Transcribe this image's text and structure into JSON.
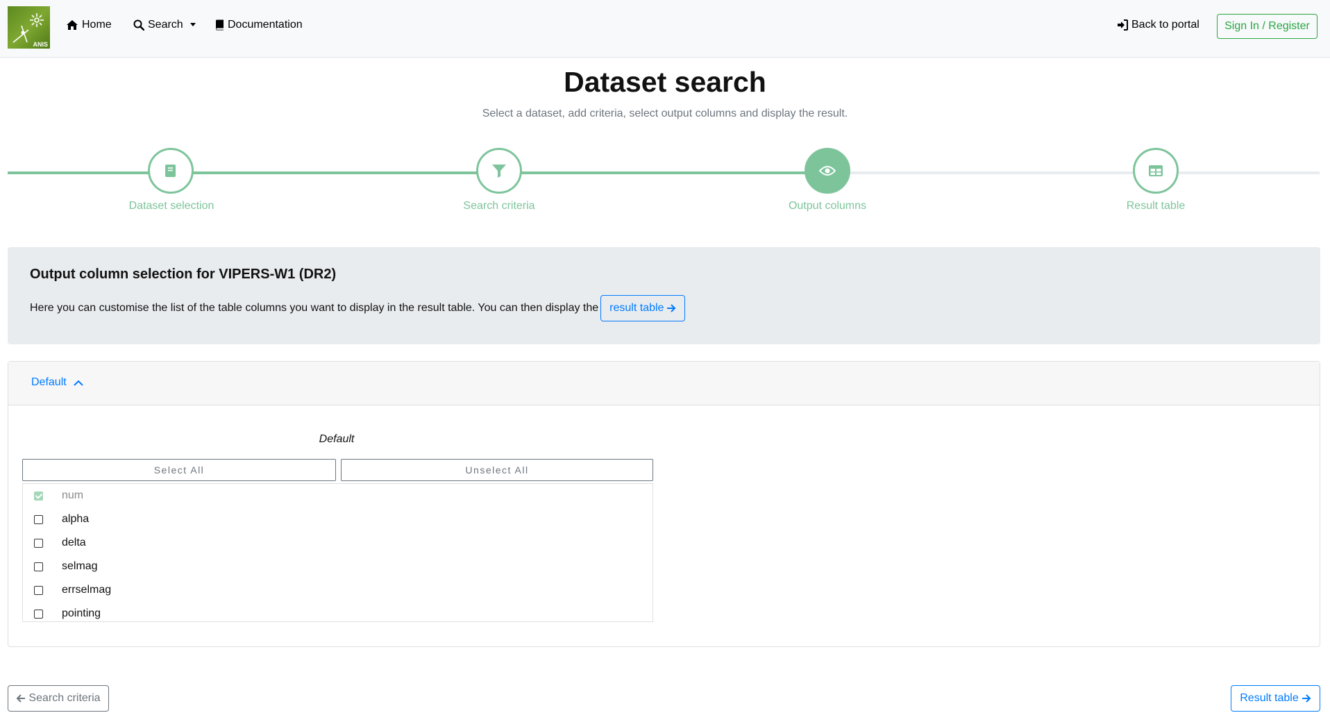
{
  "navbar": {
    "logo_text": "ANIS",
    "home_label": "Home",
    "search_label": "Search",
    "documentation_label": "Documentation",
    "back_to_portal_label": "Back to portal",
    "sign_in_label": "Sign In / Register"
  },
  "page": {
    "title": "Dataset search",
    "subtitle": "Select a dataset, add criteria, select output columns and display the result."
  },
  "stepper": {
    "steps": [
      {
        "label": "Dataset selection",
        "icon": "book-icon",
        "state": "done"
      },
      {
        "label": "Search criteria",
        "icon": "filter-icon",
        "state": "done"
      },
      {
        "label": "Output columns",
        "icon": "eye-icon",
        "state": "active"
      },
      {
        "label": "Result table",
        "icon": "table-icon",
        "state": "todo"
      }
    ]
  },
  "intro": {
    "title": "Output column selection for VIPERS-W1 (DR2)",
    "text": "Here you can customise the list of the table columns you want to display in the result table. You can then display the",
    "button_label": "result table"
  },
  "group": {
    "header_label": "Default",
    "title": "Default",
    "select_all_label": "Select All",
    "unselect_all_label": "Unselect All",
    "columns": [
      {
        "label": "num",
        "checked": true,
        "disabled": true
      },
      {
        "label": "alpha",
        "checked": false,
        "disabled": false
      },
      {
        "label": "delta",
        "checked": false,
        "disabled": false
      },
      {
        "label": "selmag",
        "checked": false,
        "disabled": false
      },
      {
        "label": "errselmag",
        "checked": false,
        "disabled": false
      },
      {
        "label": "pointing",
        "checked": false,
        "disabled": false
      }
    ]
  },
  "footer_nav": {
    "prev_label": "Search criteria",
    "next_label": "Result table"
  },
  "colors": {
    "accent_green": "#7dc49b",
    "primary_blue": "#007bff",
    "success_green": "#28a745"
  }
}
